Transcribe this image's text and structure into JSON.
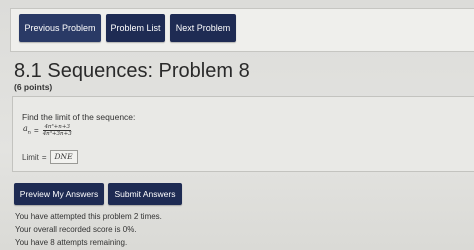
{
  "nav": {
    "previous_label": "Previous Problem",
    "list_label": "Problem List",
    "next_label": "Next Problem"
  },
  "problem": {
    "title": "8.1 Sequences: Problem 8",
    "points": "(6 points)",
    "prompt": "Find the limit of the sequence:",
    "sequence_var": "a",
    "sequence_sub": "n",
    "equals": "=",
    "numerator": "4n³+n+3",
    "denominator": "4n³+3n+3",
    "limit_label": "Limit",
    "answer_value": "DNE"
  },
  "actions": {
    "preview_label": "Preview My Answers",
    "submit_label": "Submit Answers"
  },
  "status": {
    "attempted": "You have attempted this problem 2 times.",
    "score": "Your overall recorded score is 0%.",
    "remaining": "You have 8 attempts remaining."
  },
  "colors": {
    "button_bg": "#1e2b53",
    "button_text": "#ffffff",
    "page_bg": "#e0e0dd"
  }
}
